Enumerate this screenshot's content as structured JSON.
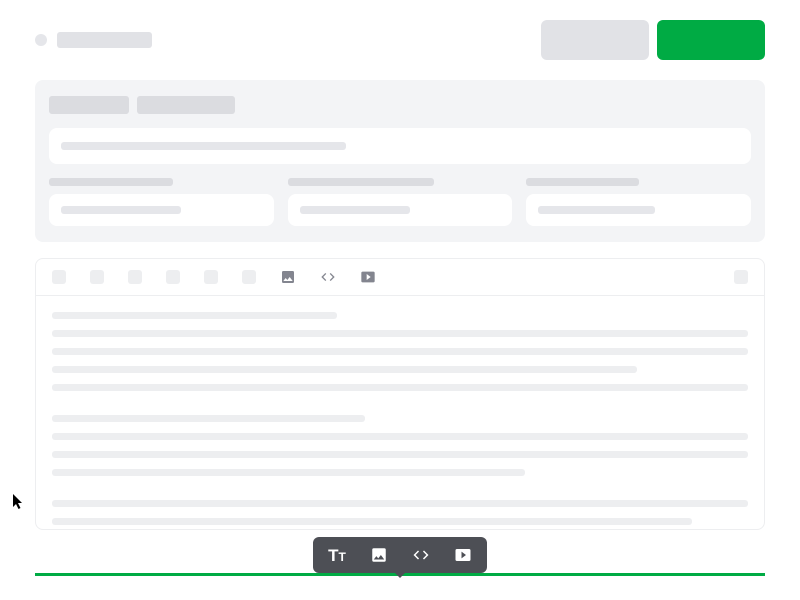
{
  "header": {
    "title": "",
    "buttons": {
      "secondary": "",
      "primary": ""
    }
  },
  "meta": {
    "tabs": [
      "",
      ""
    ],
    "title_field": "",
    "fields": [
      {
        "label": "",
        "value": ""
      },
      {
        "label": "",
        "value": ""
      },
      {
        "label": "",
        "value": ""
      }
    ]
  },
  "toolbar": {
    "icons": {
      "image": "image-icon",
      "code": "code-icon",
      "video": "video-icon"
    }
  },
  "editor": {
    "paragraphs": [
      {
        "lines": 5
      },
      {
        "lines": 4
      },
      {
        "lines": 2
      }
    ]
  },
  "floating_toolbar": {
    "items": [
      "text",
      "image",
      "code",
      "video"
    ]
  },
  "colors": {
    "primary": "#00ab44",
    "secondary": "#e1e2e6",
    "panel": "#f3f4f6",
    "skeleton": "#e5e6ea",
    "float_bg": "#4d4f55"
  }
}
